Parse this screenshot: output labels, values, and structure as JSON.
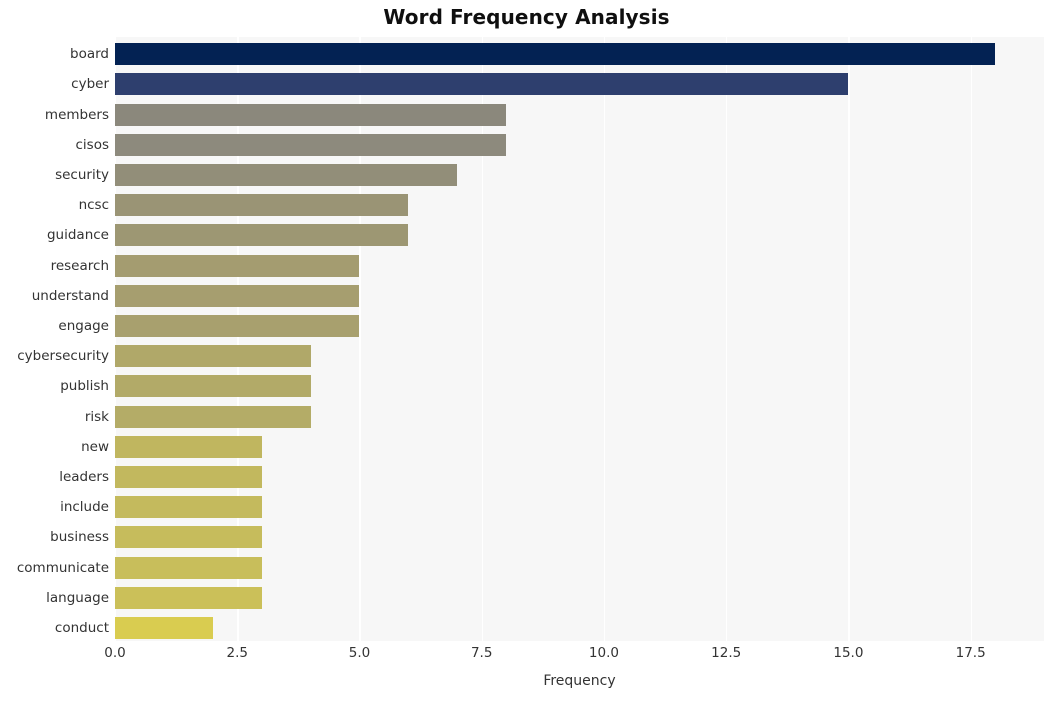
{
  "chart_data": {
    "type": "bar",
    "orientation": "horizontal",
    "title": "Word Frequency Analysis",
    "xlabel": "Frequency",
    "ylabel": "",
    "categories": [
      "board",
      "cyber",
      "members",
      "cisos",
      "security",
      "ncsc",
      "guidance",
      "research",
      "understand",
      "engage",
      "cybersecurity",
      "publish",
      "risk",
      "new",
      "leaders",
      "include",
      "business",
      "communicate",
      "language",
      "conduct"
    ],
    "values": [
      18,
      15,
      8,
      8,
      7,
      6,
      6,
      5,
      5,
      5,
      4,
      4,
      4,
      3,
      3,
      3,
      3,
      3,
      3,
      2
    ],
    "bar_colors": [
      "#032253",
      "#2e3f6e",
      "#8b887c",
      "#8d8a7d",
      "#928e79",
      "#9a9475",
      "#9d9773",
      "#a49c70",
      "#a69e6f",
      "#a8a06e",
      "#b0a869",
      "#b2aa68",
      "#b4ac67",
      "#c0b65f",
      "#c2b85e",
      "#c4ba5d",
      "#c6bc5c",
      "#c8be5b",
      "#cbc059",
      "#d9cc50"
    ],
    "xticks": [
      "0.0",
      "2.5",
      "5.0",
      "7.5",
      "10.0",
      "12.5",
      "15.0",
      "17.5"
    ],
    "xtick_values": [
      0,
      2.5,
      5,
      7.5,
      10,
      12.5,
      15,
      17.5
    ],
    "xlim": [
      0,
      19
    ],
    "grid": "vertical",
    "legend": "none",
    "plot_background": "#f7f7f7",
    "figure_background": "#ffffff",
    "gridline_color": "#ffffff",
    "title_color": "#0f0f0f",
    "tick_color": "#333333"
  }
}
